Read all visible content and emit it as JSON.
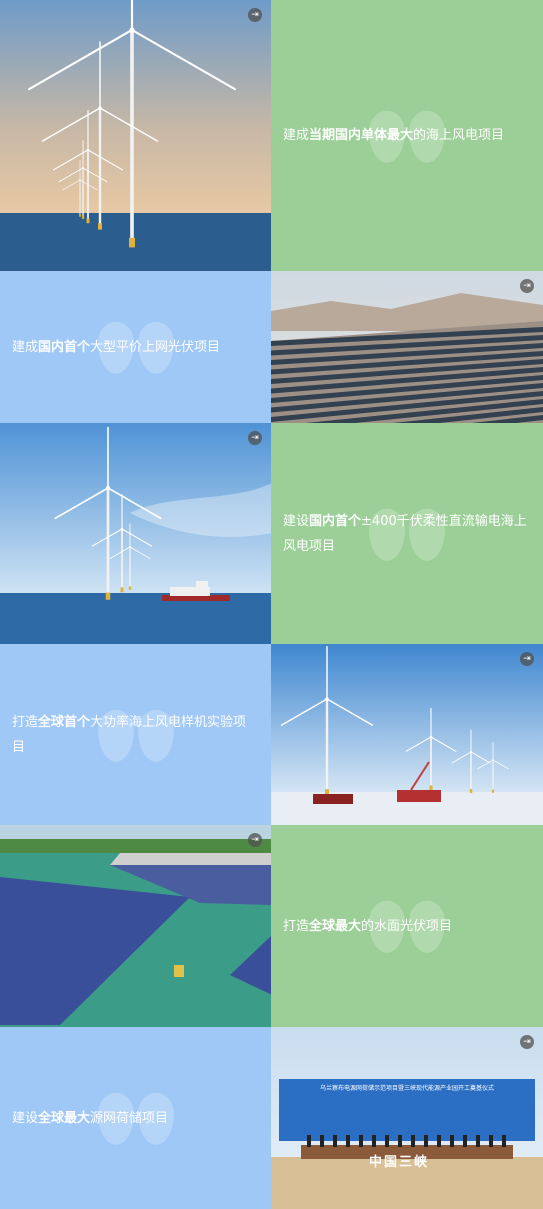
{
  "colors": {
    "green": "#9ccf98",
    "blue": "#9fc8f6"
  },
  "rows": [
    {
      "text_side": "right",
      "color": "green",
      "photo": "offshore-wind-turbines",
      "parts": [
        {
          "t": "建成",
          "b": false
        },
        {
          "t": "当期国内单体最大",
          "b": true
        },
        {
          "t": "的海上风电项目",
          "b": false
        }
      ]
    },
    {
      "text_side": "left",
      "color": "blue",
      "photo": "desert-solar-farm",
      "parts": [
        {
          "t": "建成",
          "b": false
        },
        {
          "t": "国内首个",
          "b": true
        },
        {
          "t": "大型平价上网光伏项目",
          "b": false
        }
      ]
    },
    {
      "text_side": "right",
      "color": "green",
      "photo": "offshore-wind-with-ship",
      "parts": [
        {
          "t": "建设",
          "b": false
        },
        {
          "t": "国内首个",
          "b": true
        },
        {
          "t": "±400千伏柔性直流输电海上风电项目",
          "b": false
        }
      ]
    },
    {
      "text_side": "left",
      "color": "blue",
      "photo": "turbine-installation-vessels",
      "parts": [
        {
          "t": "打造",
          "b": false
        },
        {
          "t": "全球首个",
          "b": true
        },
        {
          "t": "大功率海上风电样机实验项目",
          "b": false
        }
      ]
    },
    {
      "text_side": "right",
      "color": "green",
      "photo": "floating-solar-lake",
      "parts": [
        {
          "t": "打造",
          "b": false
        },
        {
          "t": "全球最大",
          "b": true
        },
        {
          "t": "的水面光伏项目",
          "b": false
        }
      ]
    },
    {
      "text_side": "left",
      "color": "blue",
      "photo": "groundbreaking-ceremony",
      "parts": [
        {
          "t": "建设",
          "b": false
        },
        {
          "t": "全球最大",
          "b": true
        },
        {
          "t": "源网荷储项目",
          "b": false
        }
      ]
    }
  ],
  "ceremony": {
    "banner_line1": "乌兰察布电源网荷储示范项目暨三峡现代能源产业园开工奠基仪式",
    "logo_text": "中国三峡"
  },
  "icons": {
    "expand": "expand-icon"
  }
}
